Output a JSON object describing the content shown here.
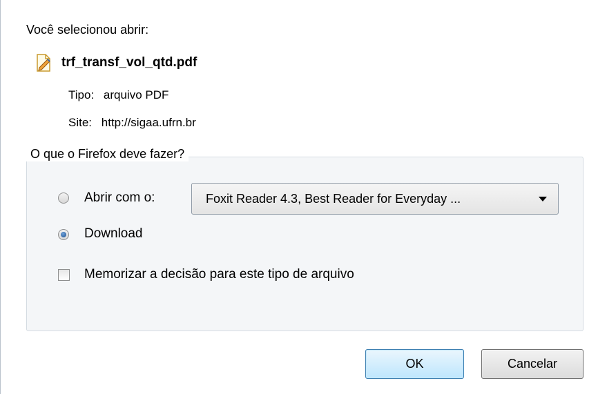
{
  "dialog": {
    "intro": "Você selecionou abrir:",
    "file_name": "trf_transf_vol_qtd.pdf",
    "file_icon": "pdf-edit-icon",
    "type_label": "Tipo:",
    "type_value": "arquivo PDF",
    "site_label": "Site:",
    "site_value": "http://sigaa.ufrn.br"
  },
  "action": {
    "group_title": "O que o Firefox deve fazer?",
    "open_with_label": "Abrir com o:",
    "open_with_app": "Foxit Reader 4.3, Best Reader for Everyday ...",
    "download_label": "Download",
    "remember_label": "Memorizar a decisão para este tipo de arquivo",
    "selected": "download",
    "remember_checked": false
  },
  "buttons": {
    "ok": "OK",
    "cancel": "Cancelar"
  },
  "colors": {
    "ok_border": "#3c7fb1",
    "radio_dot": "#1b4f8f",
    "group_background": "#f4f6f8"
  }
}
